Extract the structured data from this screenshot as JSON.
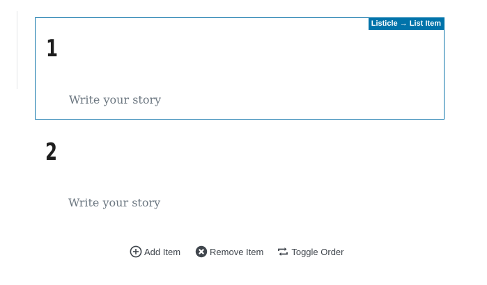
{
  "list_items": [
    {
      "number": "1",
      "placeholder": "Write your story",
      "selected": true,
      "breadcrumb": "Listicle → List Item"
    },
    {
      "number": "2",
      "placeholder": "Write your story",
      "selected": false
    }
  ],
  "actions": {
    "add_label": "Add Item",
    "remove_label": "Remove Item",
    "toggle_label": "Toggle Order"
  },
  "colors": {
    "accent": "#0073aa",
    "selected_border": "#0e74a9",
    "placeholder_text": "#6c7781",
    "number_text": "#1e1e1e",
    "action_text": "#40464d"
  },
  "icons": {
    "add": "plus-circle-icon",
    "remove": "x-circle-icon",
    "toggle": "repeat-arrows-icon"
  }
}
